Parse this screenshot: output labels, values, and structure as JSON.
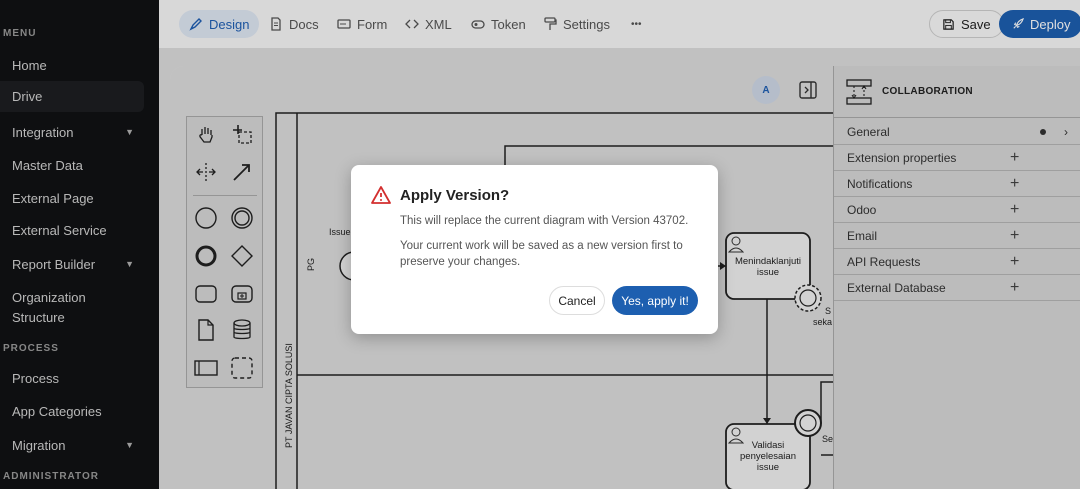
{
  "sidebar": {
    "section_menu": "MENU",
    "section_process": "PROCESS",
    "section_admin": "ADMINISTRATOR",
    "items": [
      {
        "label": "Home"
      },
      {
        "label": "Drive"
      },
      {
        "label": "Integration"
      },
      {
        "label": "Master Data"
      },
      {
        "label": "External Page"
      },
      {
        "label": "External Service"
      },
      {
        "label": "Report Builder"
      },
      {
        "label": "Organization"
      },
      {
        "label": "Structure"
      },
      {
        "label": "Process"
      },
      {
        "label": "App Categories"
      },
      {
        "label": "Migration"
      }
    ]
  },
  "toolbar": {
    "tabs": [
      "Design",
      "Docs",
      "Form",
      "XML",
      "Token",
      "Settings"
    ],
    "more": "•••",
    "save_label": "Save",
    "deploy_label": "Deploy"
  },
  "canvas": {
    "avatar_initial": "A",
    "pool_label": "PT JAVAN CIPTA SOLUSI",
    "lane_label": "PG",
    "text_issue": "Issue",
    "task_1": "Menindaklanjuti issue",
    "task_2": "Validasi penyelesaian issue",
    "frag_1": "S",
    "frag_2": "seka",
    "frag_3": "Se"
  },
  "properties": {
    "title": "COLLABORATION",
    "rows": [
      {
        "label": "General"
      },
      {
        "label": "Extension properties"
      },
      {
        "label": "Notifications"
      },
      {
        "label": "Odoo"
      },
      {
        "label": "Email"
      },
      {
        "label": "API Requests"
      },
      {
        "label": "External Database"
      }
    ],
    "plus": "+",
    "arrow": "›"
  },
  "dialog": {
    "title": "Apply Version?",
    "line1": "This will replace the current diagram with Version 43702.",
    "line2": "Your current work will be saved as a new version first to preserve your changes.",
    "cancel_label": "Cancel",
    "confirm_label": "Yes, apply it!"
  },
  "colors": {
    "accent": "#1d5fb0",
    "warning": "#d32f2f",
    "sidebar_bg": "#111214"
  }
}
